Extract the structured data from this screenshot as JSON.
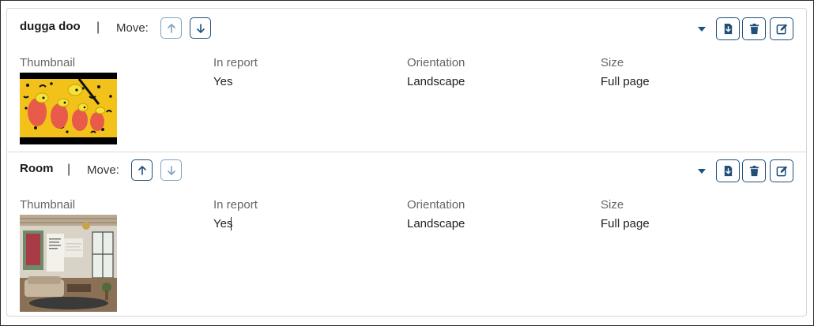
{
  "items": [
    {
      "title": "dugga doo",
      "separator": "|",
      "move_label": "Move:",
      "columns": {
        "thumbnail_label": "Thumbnail",
        "in_report_label": "In report",
        "in_report_value": "Yes",
        "orientation_label": "Orientation",
        "orientation_value": "Landscape",
        "size_label": "Size",
        "size_value": "Full page"
      },
      "icons": [
        "arrow-up-icon",
        "arrow-down-icon",
        "caret-down-icon",
        "download-icon",
        "trash-icon",
        "edit-icon"
      ]
    },
    {
      "title": "Room",
      "separator": "|",
      "move_label": "Move:",
      "columns": {
        "thumbnail_label": "Thumbnail",
        "in_report_label": "In report",
        "in_report_value": "Yes",
        "orientation_label": "Orientation",
        "orientation_value": "Landscape",
        "size_label": "Size",
        "size_value": "Full page"
      },
      "icons": [
        "arrow-up-icon",
        "arrow-down-icon",
        "caret-down-icon",
        "download-icon",
        "trash-icon",
        "edit-icon"
      ]
    }
  ],
  "colors": {
    "accent": "#1f4f7a",
    "accent_faded": "#7fa2c0",
    "border": "#d6d6d6",
    "label": "#666666"
  }
}
